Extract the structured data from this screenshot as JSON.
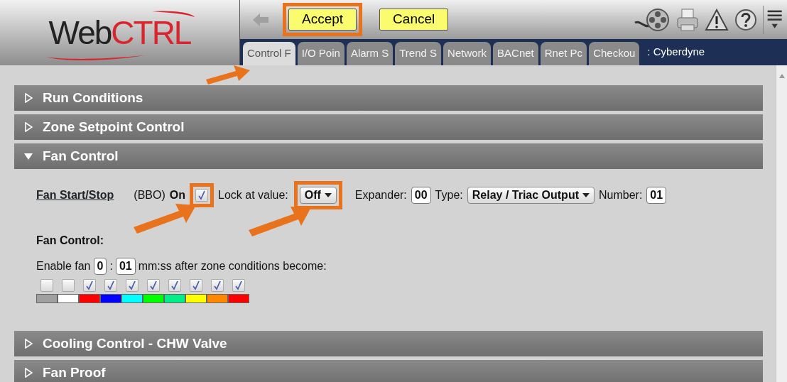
{
  "logo": {
    "text_dark": "Web",
    "text_red": "CTRL"
  },
  "toolbar": {
    "buttons": [
      {
        "label": "Accept",
        "highlighted": true
      },
      {
        "label": "Cancel",
        "highlighted": false
      }
    ]
  },
  "tabs": [
    {
      "label": "Control F",
      "selected": true
    },
    {
      "label": "I/O Poin",
      "selected": false
    },
    {
      "label": "Alarm S",
      "selected": false
    },
    {
      "label": "Trend S",
      "selected": false
    },
    {
      "label": "Network",
      "selected": false
    },
    {
      "label": "BACnet",
      "selected": false
    },
    {
      "label": "Rnet Pc",
      "selected": false
    },
    {
      "label": "Checkou",
      "selected": false
    }
  ],
  "location": ": Cyberdyne",
  "sections": [
    {
      "title": "Run Conditions",
      "expanded": false
    },
    {
      "title": "Zone Setpoint Control",
      "expanded": false
    },
    {
      "title": "Fan Control",
      "expanded": true,
      "body": {
        "point": {
          "link": "Fan Start/Stop",
          "type": "(BBO)",
          "value_label": "On",
          "lock_checked": true,
          "lock_highlighted": true,
          "lock_label": "Lock at value:",
          "lock_value": "Off",
          "lock_value_highlighted": true,
          "expander_label": "Expander:",
          "expander": "00",
          "type_label": "Type:",
          "output_type": "Relay / Triac Output",
          "number_label": "Number:",
          "number": "01"
        },
        "subtitle": "Fan Control:",
        "enable_label": "Enable fan",
        "minutes": "0",
        "separator": ":",
        "seconds": "01",
        "after_label": "mm:ss after zone conditions become:",
        "conditions": [
          {
            "checked": false,
            "color": "#a0a0a0"
          },
          {
            "checked": false,
            "color": "#ffffff"
          },
          {
            "checked": true,
            "color": "#ff0000"
          },
          {
            "checked": true,
            "color": "#0000ff"
          },
          {
            "checked": true,
            "color": "#00ffff"
          },
          {
            "checked": true,
            "color": "#00ff00"
          },
          {
            "checked": true,
            "color": "#00ee88"
          },
          {
            "checked": true,
            "color": "#ffff00"
          },
          {
            "checked": true,
            "color": "#ff8800"
          },
          {
            "checked": true,
            "color": "#ff0000"
          }
        ]
      }
    },
    {
      "title": "Cooling Control - CHW Valve",
      "expanded": false
    },
    {
      "title": "Fan Proof",
      "expanded": false
    }
  ]
}
